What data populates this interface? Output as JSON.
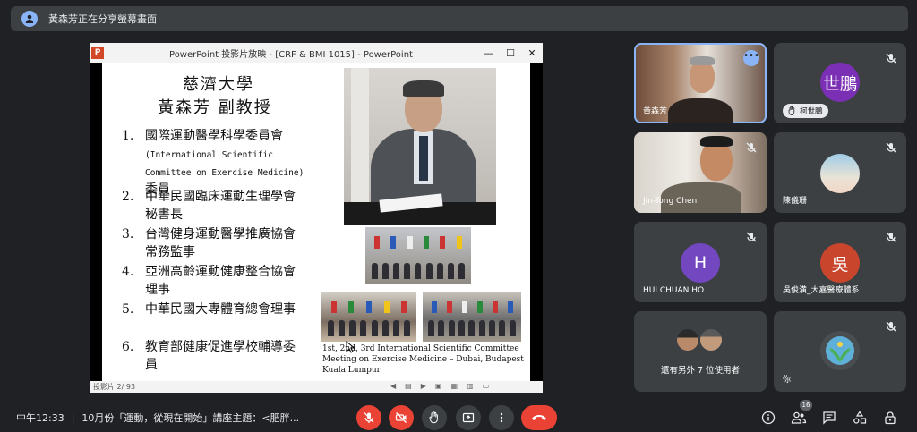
{
  "banner": {
    "text": "黃森芳正在分享螢幕畫面"
  },
  "window": {
    "title": "PowerPoint 投影片放映 - [CRF & BMI 1015] - PowerPoint",
    "minimize": "—",
    "restore": "☐",
    "close": "✕"
  },
  "slide": {
    "university": "慈濟大學",
    "professor": "黃森芳 副教授",
    "items": [
      {
        "num": "1.",
        "title": "國際運動醫學科學委員會",
        "sub": "(International Scientific Committee on Exercise Medicine)",
        "tail": "委員"
      },
      {
        "num": "2.",
        "title": "中華民國臨床運動生理學會秘書長"
      },
      {
        "num": "3.",
        "title": "台灣健身運動醫學推廣協會常務監事"
      },
      {
        "num": "4.",
        "title": "亞洲高齡運動健康整合協會理事"
      },
      {
        "num": "5.",
        "title": "中華民國大專體育總會理事"
      },
      {
        "num": "6.",
        "title": "教育部健康促進學校輔導委員"
      }
    ],
    "caption_line1": "1st, 2nd, 3rd International Scientific Committee",
    "caption_line2": "Meeting on Exercise Medicine – Dubai, Budapest",
    "caption_line3": "Kuala Lumpur",
    "status": "投影片 2/ 93"
  },
  "participants": [
    {
      "name": "黃森芳",
      "type": "video",
      "speaking": true
    },
    {
      "name": "柯世鵬",
      "initials": "世鵬",
      "color": "#7b2fb5",
      "hand_raised": true
    },
    {
      "name": "Jin-Tong Chen",
      "type": "video"
    },
    {
      "name": "陳儀珊",
      "type": "photo"
    },
    {
      "name": "HUI CHUAN HO",
      "initials": "H",
      "color": "#7247c0"
    },
    {
      "name": "吳俊潢_大嘉醫療體系",
      "initials": "吳",
      "color": "#c9462c"
    },
    {
      "name": "還有另外 7 位使用者",
      "type": "overflow"
    },
    {
      "name": "你",
      "type": "self"
    }
  ],
  "bottom": {
    "time": "中午12:33",
    "meeting": "10月份「運動，從現在開始」講座主題：<肥胖...",
    "participant_count": "16"
  },
  "colors": {
    "red": "#ea4335",
    "accent": "#8ab4f8",
    "tile": "#3c4043"
  },
  "icons": [
    "mic-off-icon",
    "camera-off-icon",
    "raise-hand-icon",
    "present-icon",
    "more-options-icon",
    "end-call-icon",
    "info-icon",
    "people-icon",
    "chat-icon",
    "activities-icon",
    "host-controls-icon"
  ]
}
